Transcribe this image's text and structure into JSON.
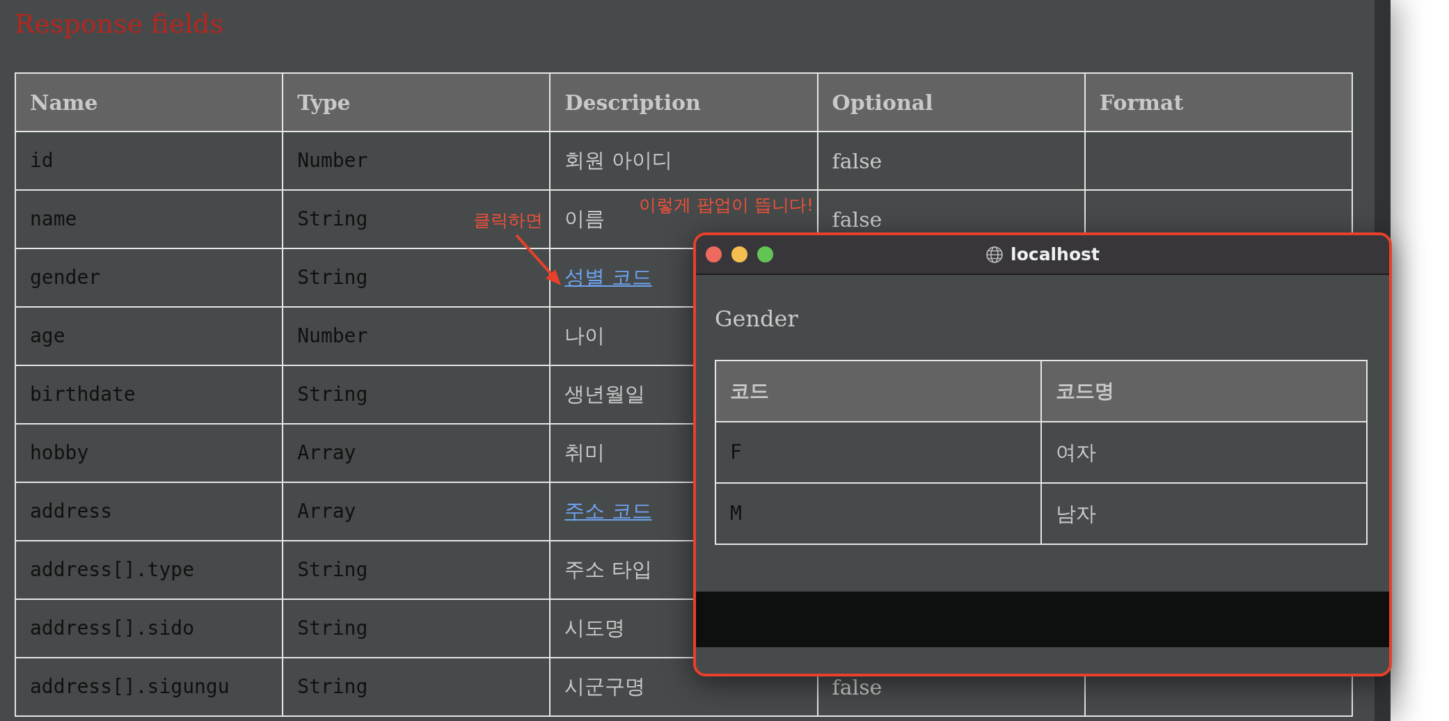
{
  "page": {
    "title": "Response fields"
  },
  "table": {
    "columns": [
      "Name",
      "Type",
      "Description",
      "Optional",
      "Format"
    ],
    "rows": [
      {
        "name": "id",
        "type": "Number",
        "description": "회원 아이디",
        "link": false,
        "optional": "false"
      },
      {
        "name": "name",
        "type": "String",
        "description": "이름",
        "link": false,
        "optional": "false"
      },
      {
        "name": "gender",
        "type": "String",
        "description": "성별 코드",
        "link": true
      },
      {
        "name": "age",
        "type": "Number",
        "description": "나이",
        "link": false
      },
      {
        "name": "birthdate",
        "type": "String",
        "description": "생년월일",
        "link": false
      },
      {
        "name": "hobby",
        "type": "Array",
        "description": "취미",
        "link": false
      },
      {
        "name": "address",
        "type": "Array",
        "description": "주소 코드",
        "link": true
      },
      {
        "name": "address[].type",
        "type": "String",
        "description": "주소 타입",
        "link": false
      },
      {
        "name": "address[].sido",
        "type": "String",
        "description": "시도명",
        "link": false
      },
      {
        "name": "address[].sigungu",
        "type": "String",
        "description": "시군구명",
        "link": false,
        "optional": "false"
      }
    ]
  },
  "annotations": [
    {
      "text": "클릭하면",
      "arrow": true
    },
    {
      "text": "이렇게 팝업이 뜹니다!",
      "arrow": false
    }
  ],
  "popup": {
    "title": "localhost",
    "heading": "Gender",
    "table": {
      "columns": [
        "코드",
        "코드명"
      ],
      "rows": [
        [
          "F",
          "여자"
        ],
        [
          "M",
          "남자"
        ]
      ]
    }
  }
}
